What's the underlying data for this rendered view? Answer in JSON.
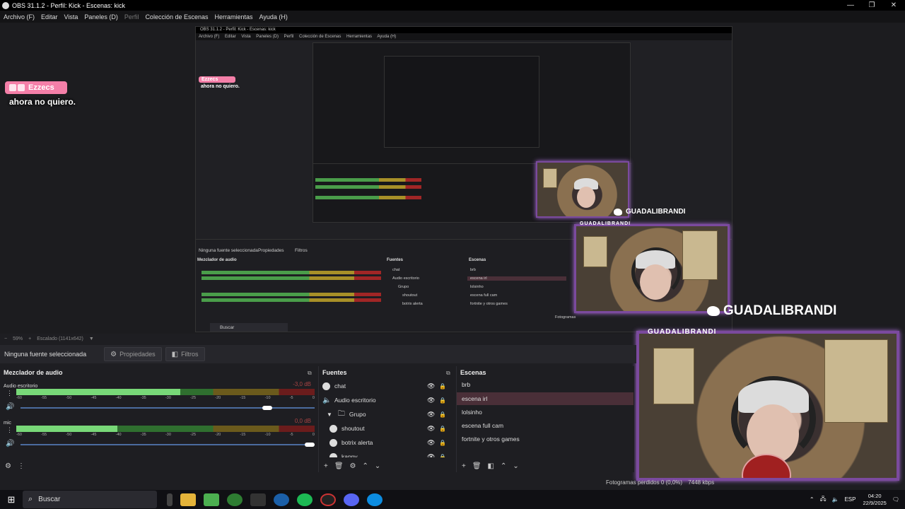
{
  "window": {
    "title": "OBS 31.1.2 - Perfil: Kick - Escenas: kick",
    "controls": [
      "—",
      "❐",
      "✕"
    ]
  },
  "menu": {
    "items": [
      "Archivo (F)",
      "Editar",
      "Vista",
      "Paneles (D)",
      "Perfil",
      "Colección de Escenas",
      "Herramientas",
      "Ayuda (H)"
    ]
  },
  "preview": {
    "chat_name": "Ezzecs",
    "chat_message": "ahora no quiero.",
    "nested_title": "OBS 31.1.2 - Perfil: Kick - Escenas: kick",
    "nested_menu": [
      "Archivo (F)",
      "Editar",
      "Vista",
      "Paneles (D)",
      "Perfil",
      "Colección de Escenas",
      "Herramientas",
      "Ayuda (H)"
    ],
    "nested_chat_name": "Ezzecs",
    "nested_chat_message": "ahora no quiero.",
    "nested_no_source": "Ninguna fuente seleccionada",
    "nested_props": "Propiedades",
    "nested_filters": "Filtros",
    "nested_mixer_title": "Mezclador de audio",
    "nested_sources_title": "Fuentes",
    "nested_scenes_title": "Escenas",
    "nested_sources": [
      "chat",
      "Audio escritorio",
      "Grupo",
      "shoutout",
      "botrix alerta"
    ],
    "nested_scenes": [
      "brb",
      "escena irl",
      "lolsinho",
      "escena full cam",
      "fortnite y otros games"
    ],
    "nested_search": "Buscar",
    "nested_zoom": "Escalado (1141x642)",
    "cam_label": "GUADALIBRANDI",
    "twitter_handle": "GUADALIBRANDI",
    "twitter_handle_small": "GUADALIBRANDI",
    "nested_fps": "Fotogramas"
  },
  "zoom": {
    "minus": "−",
    "percent": "59%",
    "plus": "+",
    "scaled": "Escalado (1141x642)"
  },
  "source_bar": {
    "no_source": "Ninguna fuente seleccionada",
    "properties": "Propiedades",
    "filters": "Filtros"
  },
  "mixer": {
    "title": "Mezclador de audio",
    "channels": [
      {
        "name": "Audio escritorio",
        "db": "-3,0 dB",
        "level": 0.55,
        "volume": 0.85
      },
      {
        "name": "mic",
        "db": "0,0 dB",
        "level": 0.34,
        "volume": 1.0
      }
    ],
    "scale": [
      "-60",
      "-55",
      "-50",
      "-45",
      "-40",
      "-35",
      "-30",
      "-25",
      "-20",
      "-15",
      "-10",
      "-5",
      "0"
    ]
  },
  "sources": {
    "title": "Fuentes",
    "items": [
      {
        "label": "chat",
        "indent": 0
      },
      {
        "label": "Audio escritorio",
        "indent": 0
      },
      {
        "label": "Grupo",
        "indent": 1
      },
      {
        "label": "shoutout",
        "indent": 2
      },
      {
        "label": "botrix alerta",
        "indent": 2
      },
      {
        "label": "kappy",
        "indent": 2
      }
    ]
  },
  "scenes": {
    "title": "Escenas",
    "items": [
      "brb",
      "escena irl",
      "lolsinho",
      "escena full cam",
      "fortnite y otros games"
    ],
    "active_index": 1
  },
  "status": {
    "frames": "Fotogramas perdidos 0 (0,0%)",
    "kbps": "7448 kbps"
  },
  "taskbar": {
    "search": "Buscar",
    "lang": "ESP",
    "time": "04:20",
    "date": "22/9/2025"
  },
  "colors": {
    "accent_pink": "#f47fa8",
    "cam_border": "#7b4a9e",
    "scene_active": "#4a2f38"
  }
}
